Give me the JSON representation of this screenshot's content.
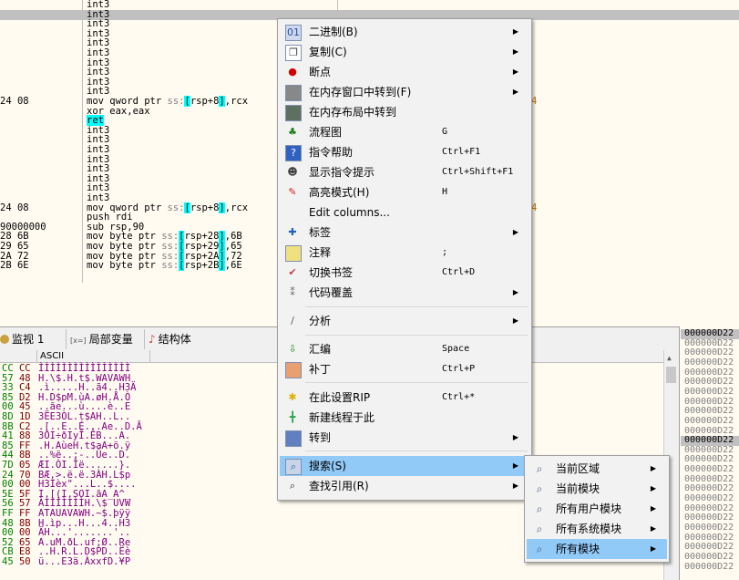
{
  "disasm": {
    "rows": [
      {
        "addr": "",
        "instr": [
          {
            "t": "int3",
            "c": "int"
          }
        ]
      },
      {
        "addr": "",
        "instr": [
          {
            "t": "int3",
            "c": "int"
          }
        ],
        "sel": true
      },
      {
        "addr": "",
        "instr": [
          {
            "t": "int3",
            "c": "int"
          }
        ]
      },
      {
        "addr": "",
        "instr": [
          {
            "t": "int3",
            "c": "int"
          }
        ]
      },
      {
        "addr": "",
        "instr": [
          {
            "t": "int3",
            "c": "int"
          }
        ]
      },
      {
        "addr": "",
        "instr": [
          {
            "t": "int3",
            "c": "int"
          }
        ]
      },
      {
        "addr": "",
        "instr": [
          {
            "t": "int3",
            "c": "int"
          }
        ]
      },
      {
        "addr": "",
        "instr": [
          {
            "t": "int3",
            "c": "int"
          }
        ]
      },
      {
        "addr": "",
        "instr": [
          {
            "t": "int3",
            "c": "int"
          }
        ]
      },
      {
        "addr": "",
        "instr": [
          {
            "t": "int3",
            "c": "int"
          }
        ]
      },
      {
        "addr": "24 08",
        "instr": [
          {
            "t": "mov qword ptr ",
            "c": "kw"
          },
          {
            "t": "ss:",
            "c": "seg"
          },
          {
            "t": "[",
            "c": "br"
          },
          {
            "t": "rsp+8",
            "c": "reg"
          },
          {
            "t": "]",
            "c": "br"
          },
          {
            "t": ",rcx",
            "c": "reg"
          }
        ]
      },
      {
        "addr": "",
        "instr": [
          {
            "t": "xor eax,eax",
            "c": "kw"
          }
        ]
      },
      {
        "addr": "",
        "instr": [
          {
            "t": "ret",
            "c": "ret"
          }
        ]
      },
      {
        "addr": "",
        "instr": [
          {
            "t": "int3",
            "c": "int"
          }
        ]
      },
      {
        "addr": "",
        "instr": [
          {
            "t": "int3",
            "c": "int"
          }
        ]
      },
      {
        "addr": "",
        "instr": [
          {
            "t": "int3",
            "c": "int"
          }
        ]
      },
      {
        "addr": "",
        "instr": [
          {
            "t": "int3",
            "c": "int"
          }
        ]
      },
      {
        "addr": "",
        "instr": [
          {
            "t": "int3",
            "c": "int"
          }
        ]
      },
      {
        "addr": "",
        "instr": [
          {
            "t": "int3",
            "c": "int"
          }
        ]
      },
      {
        "addr": "",
        "instr": [
          {
            "t": "int3",
            "c": "int"
          }
        ]
      },
      {
        "addr": "",
        "instr": [
          {
            "t": "int3",
            "c": "int"
          }
        ]
      },
      {
        "addr": "24 08",
        "instr": [
          {
            "t": "mov qword ptr ",
            "c": "kw"
          },
          {
            "t": "ss:",
            "c": "seg"
          },
          {
            "t": "[",
            "c": "br"
          },
          {
            "t": "rsp+8",
            "c": "reg"
          },
          {
            "t": "]",
            "c": "br"
          },
          {
            "t": ",rcx",
            "c": "reg"
          }
        ]
      },
      {
        "addr": "",
        "instr": [
          {
            "t": "push rdi",
            "c": "kw"
          }
        ]
      },
      {
        "addr": "90000000",
        "instr": [
          {
            "t": "sub rsp,90",
            "c": "kw"
          }
        ]
      },
      {
        "addr": "28 6B",
        "instr": [
          {
            "t": "mov byte ptr ",
            "c": "kw"
          },
          {
            "t": "ss:",
            "c": "seg"
          },
          {
            "t": "[",
            "c": "br"
          },
          {
            "t": "rsp+28",
            "c": "reg"
          },
          {
            "t": "]",
            "c": "br"
          },
          {
            "t": ",6B",
            "c": "num"
          }
        ]
      },
      {
        "addr": "29 65",
        "instr": [
          {
            "t": "mov byte ptr ",
            "c": "kw"
          },
          {
            "t": "ss:",
            "c": "seg"
          },
          {
            "t": "[",
            "c": "br"
          },
          {
            "t": "rsp+29",
            "c": "reg"
          },
          {
            "t": "]",
            "c": "br"
          },
          {
            "t": ",65",
            "c": "num"
          }
        ]
      },
      {
        "addr": "2A 72",
        "instr": [
          {
            "t": "mov byte ptr ",
            "c": "kw"
          },
          {
            "t": "ss:",
            "c": "seg"
          },
          {
            "t": "[",
            "c": "br"
          },
          {
            "t": "rsp+2A",
            "c": "reg"
          },
          {
            "t": "]",
            "c": "br"
          },
          {
            "t": ",72",
            "c": "num"
          }
        ]
      },
      {
        "addr": "2B 6E",
        "instr": [
          {
            "t": "mov byte ptr ",
            "c": "kw"
          },
          {
            "t": "ss:",
            "c": "seg"
          },
          {
            "t": "[",
            "c": "br"
          },
          {
            "t": "rsp+2B",
            "c": "reg"
          },
          {
            "t": "]",
            "c": "br"
          },
          {
            "t": ",6E",
            "c": "num"
          }
        ]
      }
    ],
    "right_marks": [
      {
        "row": 10,
        "t": "4"
      },
      {
        "row": 21,
        "t": "4"
      }
    ]
  },
  "bottom_tabs": [
    {
      "label": "监视 1",
      "icon": "watch-icon"
    },
    {
      "label": "局部变量",
      "icon": "locals-icon",
      "prefix": "[x=]"
    },
    {
      "label": "结构体",
      "icon": "struct-icon"
    }
  ],
  "hex": {
    "ascii_header": "ASCII",
    "rows": [
      {
        "hex": "CC CC",
        "ascii": "ÌÌÌÌÌÌÌÌÌÌÌÌÌÌÌÌ"
      },
      {
        "hex": "57 48",
        "ascii": "H.\\$.H.t$.WAVAWH"
      },
      {
        "hex": "33 C4",
        "ascii": ".ì.....H..ã4..H3Ä"
      },
      {
        "hex": "85 D2",
        "ascii": "H.D$pM.ùA.øH.Å.Ò"
      },
      {
        "hex": "00 45",
        "ascii": "..ãe...ù....è..E"
      },
      {
        "hex": "8D 1D",
        "ascii": "3ËE3ÒL.t$AH..L.."
      },
      {
        "hex": "8B C2",
        "ascii": ".[..E..É...Ae..D.Â"
      },
      {
        "hex": "41 88",
        "ascii": "3ÒI÷ðIyÎ.ÊB...A."
      },
      {
        "hex": "85 FF",
        "ascii": ".H.AùeH.t$aA+ö.ÿ"
      },
      {
        "hex": "44 8B",
        "ascii": "..%ë..;-..Ûe..D."
      },
      {
        "hex": "7D 05",
        "ascii": "ÆI.ÒI.Îë......}."
      },
      {
        "hex": "24 70",
        "ascii": "BÆ.>.ë.ë.3ÀH.L$p"
      },
      {
        "hex": "00 00",
        "ascii": "H3Ìèx\"...L..$...."
      },
      {
        "hex": "5E 5F",
        "ascii": "I.[(I.SOI.ãA_A^_"
      },
      {
        "hex": "56 57",
        "ascii": "ÀÌÌÌÌÌÌÌH.\\$ UVW"
      },
      {
        "hex": "FF FF",
        "ascii": "ATAUAVAWH.~$.þÿÿ"
      },
      {
        "hex": "48 8B",
        "ascii": "H.ìp...H...4..H3"
      },
      {
        "hex": "00 00",
        "ascii": "ÄH...'.......'.."
      },
      {
        "hex": "52 65",
        "ascii": "A.uM.ðL.uf;Ø..Re"
      },
      {
        "hex": "CB E8",
        "ascii": "..H.R.L.D$PD..Ëè"
      },
      {
        "hex": "45 50",
        "ascii": "ü...E3ä.ÀxxfD.¥P"
      }
    ]
  },
  "stack": {
    "rows": [
      "000000D22",
      "000000D22",
      "000000D22",
      "000000D22",
      "000000D22",
      "000000D22",
      "000000D22",
      "000000D22",
      "000000D22",
      "000000D22",
      "000000D22",
      "000000D22",
      "000000D22",
      "000000D22",
      "000000D22",
      "000000D22",
      "000000D22",
      "000000D22",
      "000000D22",
      "000000D22",
      "000000D22",
      "000000D22",
      "000000D22",
      "000000D22",
      "000000D22"
    ],
    "highlight": [
      0,
      11
    ]
  },
  "context_menu": {
    "items": [
      {
        "label": "二进制(B)",
        "shortcut": "",
        "arrow": true,
        "icon": "binary-icon"
      },
      {
        "label": "复制(C)",
        "shortcut": "",
        "arrow": true,
        "icon": "copy-icon"
      },
      {
        "label": "断点",
        "shortcut": "",
        "arrow": true,
        "icon": "breakpoint-icon"
      },
      {
        "label": "在内存窗口中转到(F)",
        "shortcut": "",
        "arrow": true,
        "icon": "memory-window-icon"
      },
      {
        "label": "在内存布局中转到",
        "shortcut": "",
        "arrow": false,
        "icon": "memory-map-icon"
      },
      {
        "label": "流程图",
        "shortcut": "G",
        "arrow": false,
        "icon": "graph-icon"
      },
      {
        "label": "指令帮助",
        "shortcut": "Ctrl+F1",
        "arrow": false,
        "icon": "help-icon"
      },
      {
        "label": "显示指令提示",
        "shortcut": "Ctrl+Shift+F1",
        "arrow": false,
        "icon": "hint-icon"
      },
      {
        "label": "高亮模式(H)",
        "shortcut": "H",
        "arrow": false,
        "icon": "highlight-icon"
      },
      {
        "label": "Edit columns...",
        "shortcut": "",
        "arrow": false,
        "icon": ""
      },
      {
        "label": "标签",
        "shortcut": "",
        "arrow": true,
        "icon": "label-icon"
      },
      {
        "label": "注释",
        "shortcut": ";",
        "arrow": false,
        "icon": "comment-icon"
      },
      {
        "label": "切换书签",
        "shortcut": "Ctrl+D",
        "arrow": false,
        "icon": "bookmark-icon"
      },
      {
        "label": "代码覆盖",
        "shortcut": "",
        "arrow": true,
        "icon": "coverage-icon"
      },
      {
        "label": "分析",
        "shortcut": "",
        "arrow": true,
        "icon": "analyze-icon"
      },
      {
        "label": "汇编",
        "shortcut": "Space",
        "arrow": false,
        "icon": "assemble-icon"
      },
      {
        "label": "补丁",
        "shortcut": "Ctrl+P",
        "arrow": false,
        "icon": "patch-icon"
      },
      {
        "label": "在此设置RIP",
        "shortcut": "Ctrl+*",
        "arrow": false,
        "icon": "set-rip-icon"
      },
      {
        "label": "新建线程于此",
        "shortcut": "",
        "arrow": false,
        "icon": "new-thread-icon"
      },
      {
        "label": "转到",
        "shortcut": "",
        "arrow": true,
        "icon": "goto-icon"
      },
      {
        "label": "搜索(S)",
        "shortcut": "",
        "arrow": true,
        "icon": "search-icon",
        "active": true
      },
      {
        "label": "查找引用(R)",
        "shortcut": "",
        "arrow": true,
        "icon": "find-refs-icon"
      }
    ]
  },
  "submenu": {
    "items": [
      {
        "label": "当前区域",
        "icon": "search-region-icon"
      },
      {
        "label": "当前模块",
        "icon": "search-module-icon"
      },
      {
        "label": "所有用户模块",
        "icon": "search-user-modules-icon"
      },
      {
        "label": "所有系统模块",
        "icon": "search-system-modules-icon"
      },
      {
        "label": "所有模块",
        "icon": "search-all-modules-icon",
        "active": true
      }
    ]
  }
}
